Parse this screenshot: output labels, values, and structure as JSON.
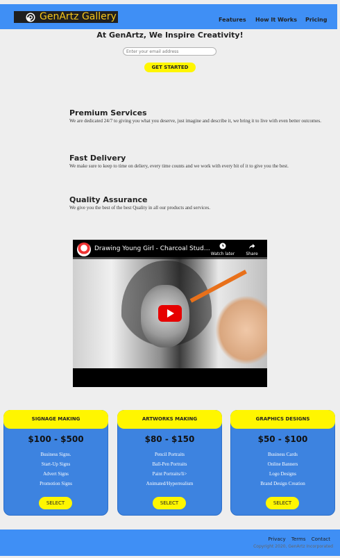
{
  "header": {
    "logo_text": "GenArtz Gallery",
    "nav": [
      "Features",
      "How It Works",
      "Pricing"
    ]
  },
  "hero": {
    "title": "At GenArtz, We Inspire Creativity!",
    "email_placeholder": "Enter your email address",
    "cta": "GET STARTED"
  },
  "features": [
    {
      "title": "Premium Services",
      "text": "We are dedicated 24/7 to giving you what you deserve, just imagine and describe it, we bring it to live with even better outcomes."
    },
    {
      "title": "Fast Delivery",
      "text": "We make sure to keep to time on deliery, every time counts and we work with every bit of it to give you the best."
    },
    {
      "title": "Quality Assurance",
      "text": "We give you the best of the best Quality in all our products and services."
    }
  ],
  "video": {
    "title": "Drawing Young Girl - Charcoal Study #i-...",
    "watch_later": "Watch later",
    "share": "Share"
  },
  "pricing": [
    {
      "name": "SIGNAGE MAKING",
      "price": "$100 - $500",
      "items": [
        "Business Signs.",
        "Start-Up Signs",
        "Advert Signs",
        "Promotion Signs"
      ],
      "button": "SELECT"
    },
    {
      "name": "ARTWORKS MAKING",
      "price": "$80 - $150",
      "items": [
        "Pencil Portraits",
        "Ball-Pen Portraits",
        "Paint Portraits/li>",
        "Animated/Hyperrealism"
      ],
      "button": "SELECT"
    },
    {
      "name": "GRAPHICS DESIGNS",
      "price": "$50 - $100",
      "items": [
        "Business Cards",
        "Online Banners",
        "Logo Designs",
        "Brand Design Creation"
      ],
      "button": "SELECT"
    }
  ],
  "footer": {
    "links": [
      "Privacy",
      "Terms",
      "Contact"
    ],
    "copyright": "Copyright 2020, GenArtz Incorporated"
  },
  "colors": {
    "header_bg": "#3f8ff5",
    "accent": "#fff600",
    "card_bg": "#3d83e0",
    "logo_text": "#f5c51a"
  }
}
